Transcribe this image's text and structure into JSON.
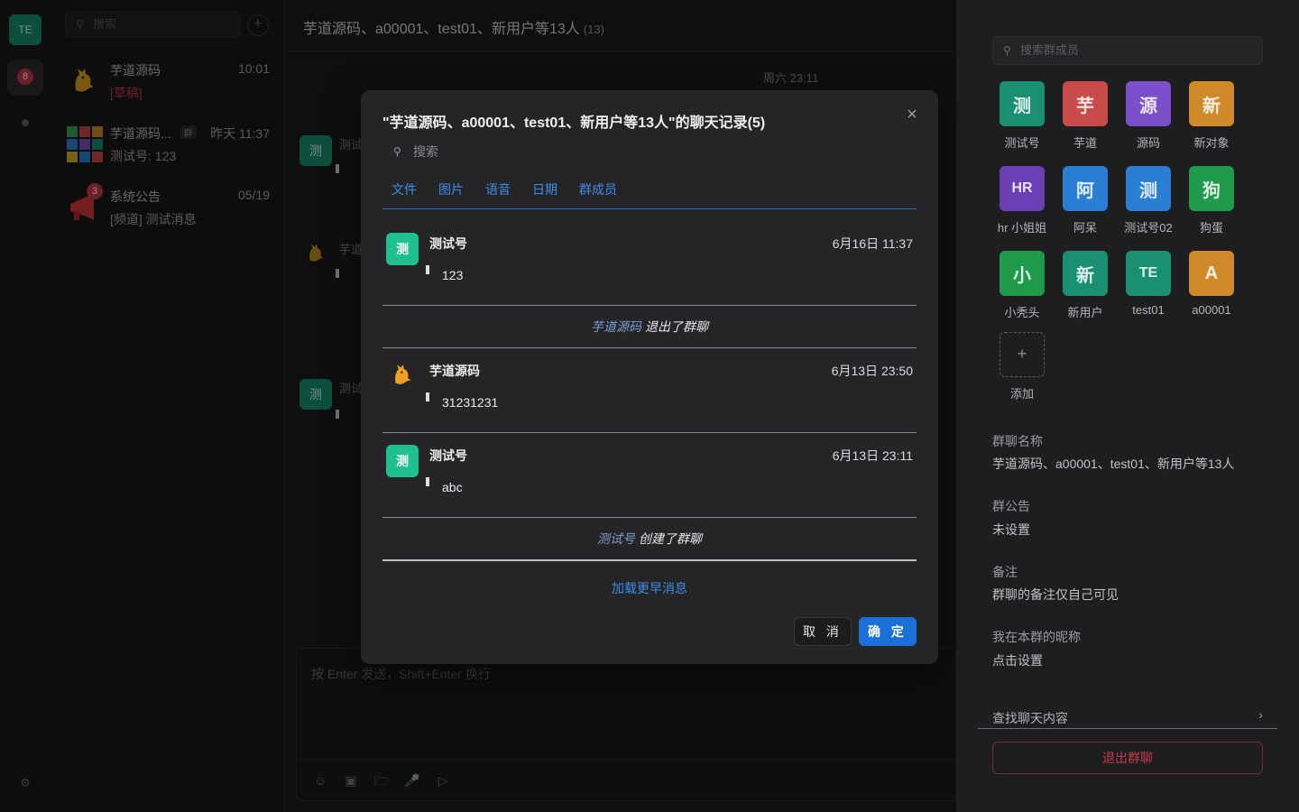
{
  "nav": {
    "user_avatar": "TE",
    "unread_count": "8",
    "icons": [
      "chat-icon",
      "contacts-icon",
      "settings-icon"
    ]
  },
  "conversations": {
    "search_placeholder": "搜索",
    "items": [
      {
        "name": "芋道源码",
        "time": "10:01",
        "subtitle": "[草稿]",
        "subtitle_color": "#c7374a"
      },
      {
        "name": "芋道源码...",
        "tag": "群",
        "time": "昨天 11:37",
        "subtitle": "测试号: 123"
      },
      {
        "name": "系统公告",
        "time": "05/19",
        "subtitle": "[频道] 测试消息",
        "badge": "3"
      }
    ]
  },
  "chat": {
    "title": "芋道源码、a00001、test01、新用户等13人",
    "member_count": "(13)",
    "date_divider": "周六 23:11",
    "bg_messages": [
      {
        "avatar": "测",
        "name": "测试"
      },
      {
        "name": "芋道"
      },
      {
        "avatar": "测",
        "name": "测试"
      }
    ],
    "composer_placeholder": "按 Enter 发送，Shift+Enter 换行",
    "toolbar_icons": [
      "emoji-icon",
      "image-icon",
      "folder-icon",
      "mic-icon",
      "video-icon"
    ]
  },
  "modal": {
    "title": "\"芋道源码、a00001、test01、新用户等13人\"的聊天记录(5)",
    "search_placeholder": "搜索",
    "tabs": [
      "文件",
      "图片",
      "语音",
      "日期",
      "群成员"
    ],
    "records": [
      {
        "type": "message",
        "avatar": "测",
        "name": "测试号",
        "time": "6月16日 11:37",
        "text": "123"
      },
      {
        "type": "system",
        "who": "芋道源码",
        "action": "退出了群聊"
      },
      {
        "type": "message",
        "avatar": "",
        "name": "芋道源码",
        "time": "6月13日 23:50",
        "text": "31231231"
      },
      {
        "type": "message",
        "avatar": "测",
        "name": "测试号",
        "time": "6月13日 23:11",
        "text": "abc"
      },
      {
        "type": "system",
        "who": "测试号",
        "action": "创建了群聊"
      }
    ],
    "load_more": "加载更早消息",
    "cancel_label": "取 消",
    "ok_label": "确 定"
  },
  "panel": {
    "search_placeholder": "搜索群成员",
    "members": [
      {
        "avatar": "测",
        "name": "测试号",
        "color": "#1a8f72"
      },
      {
        "avatar": "芋",
        "name": "芋道",
        "color": "#c94a4a"
      },
      {
        "avatar": "源",
        "name": "源码",
        "color": "#7a4fc9"
      },
      {
        "avatar": "新",
        "name": "新对象",
        "color": "#d08a2a"
      },
      {
        "avatar": "HR",
        "name": "hr 小姐姐",
        "color": "#6a3fb3"
      },
      {
        "avatar": "阿",
        "name": "阿呆",
        "color": "#2a7fd4"
      },
      {
        "avatar": "测",
        "name": "测试号02",
        "color": "#2a7fd4"
      },
      {
        "avatar": "狗",
        "name": "狗蛋",
        "color": "#1f9a4a"
      },
      {
        "avatar": "小",
        "name": "小秃头",
        "color": "#1f9a4a"
      },
      {
        "avatar": "新",
        "name": "新用户",
        "color": "#1a8f72"
      },
      {
        "avatar": "TE",
        "name": "test01",
        "color": "#1a8f72"
      },
      {
        "avatar": "A",
        "name": "a00001",
        "color": "#d08a2a"
      }
    ],
    "add_label": "添加",
    "group_name_label": "群聊名称",
    "group_name_value": "芋道源码、a00001、test01、新用户等13人",
    "notice_label": "群公告",
    "notice_value": "未设置",
    "remark_label": "备注",
    "remark_value": "群聊的备注仅自己可见",
    "nickname_label": "我在本群的昵称",
    "nickname_value": "点击设置",
    "find_label": "查找聊天内容",
    "exit_label": "退出群聊"
  }
}
